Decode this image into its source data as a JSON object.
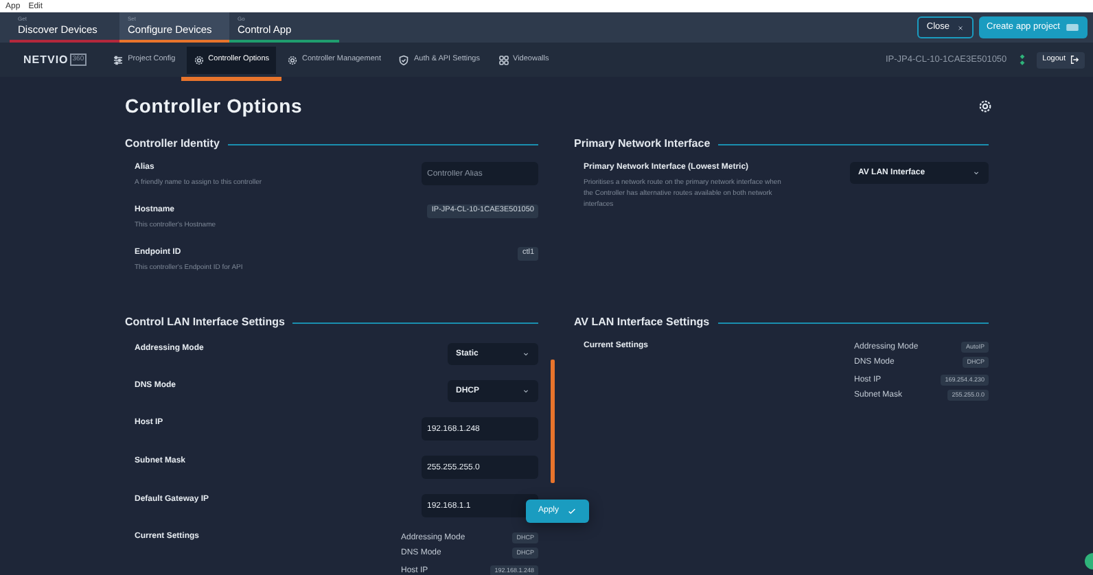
{
  "menu_bar": [
    "App",
    "Edit"
  ],
  "steps": [
    {
      "caption": "Get",
      "label": "Discover Devices",
      "selected": false,
      "color": "#b4283c"
    },
    {
      "caption": "Set",
      "label": "Configure Devices",
      "selected": true,
      "color": "#e8742c"
    },
    {
      "caption": "Go",
      "label": "Control App",
      "selected": false,
      "color": "#1f9d6e"
    }
  ],
  "header_buttons": {
    "close": "Close",
    "create": "Create app project"
  },
  "nav": {
    "logo": "NETVIO",
    "logo_badge": "360",
    "tabs": [
      {
        "label": "Project Config",
        "kind": "sliders",
        "selected": false
      },
      {
        "label": "Controller Options",
        "kind": "gear",
        "selected": true
      },
      {
        "label": "Controller Management",
        "kind": "gear",
        "selected": false
      },
      {
        "label": "Auth & API Settings",
        "kind": "shield",
        "selected": false
      },
      {
        "label": "Videowalls",
        "kind": "grid",
        "selected": false
      }
    ],
    "hostname": "IP-JP4-CL-10-1CAE3E501050",
    "logout": "Logout"
  },
  "page_title": "Controller Options",
  "controller_identity": {
    "title": "Controller Identity",
    "rows": [
      {
        "kind": "input",
        "label": "Alias",
        "description": "A friendly name to assign to this controller",
        "placeholder": "Controller Alias"
      },
      {
        "kind": "readonly",
        "label": "Hostname",
        "description": "This controller's Hostname",
        "value": "IP-JP4-CL-10-1CAE3E501050"
      },
      {
        "kind": "readonly",
        "label": "Endpoint ID",
        "description": "This controller's Endpoint ID for API",
        "value": "ctl1"
      }
    ]
  },
  "primary_network": {
    "title": "Primary Network Interface",
    "rows": [
      {
        "kind": "select",
        "label": "Primary Network Interface (Lowest Metric)",
        "description": "Prioritises a network route on the primary network interface when the Controller has alternative routes available on both network interfaces",
        "value": "AV LAN Interface"
      }
    ]
  },
  "control_lan": {
    "title": "Control LAN Interface Settings",
    "rows": [
      {
        "kind": "select",
        "label": "Addressing Mode",
        "value": "Static"
      },
      {
        "kind": "select",
        "label": "DNS Mode",
        "value": "DHCP"
      },
      {
        "kind": "text",
        "label": "Host IP",
        "value": "192.168.1.248"
      },
      {
        "kind": "text",
        "label": "Subnet Mask",
        "value": "255.255.255.0"
      },
      {
        "kind": "text",
        "label": "Default Gateway IP",
        "value": "192.168.1.1"
      }
    ],
    "current_settings": {
      "label": "Current Settings",
      "groups": [
        [
          {
            "label": "Addressing Mode",
            "value": "DHCP"
          },
          {
            "label": "DNS Mode",
            "value": "DHCP"
          }
        ],
        [
          {
            "label": "Host IP",
            "value": "192.168.1.248"
          }
        ]
      ]
    }
  },
  "av_lan": {
    "title": "AV LAN Interface Settings",
    "current_settings": {
      "label": "Current Settings",
      "groups": [
        [
          {
            "label": "Addressing Mode",
            "value": "AutoIP"
          },
          {
            "label": "DNS Mode",
            "value": "DHCP"
          }
        ],
        [
          {
            "label": "Host IP",
            "value": "169.254.4.230"
          },
          {
            "label": "Subnet Mask",
            "value": "255.255.0.0"
          }
        ]
      ]
    }
  },
  "apply_button": "Apply"
}
